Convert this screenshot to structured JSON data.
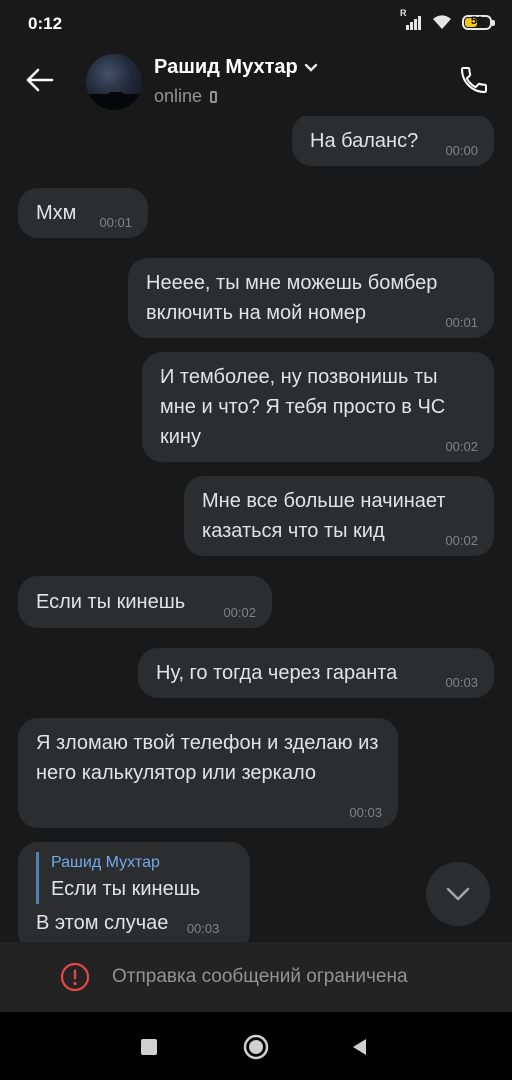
{
  "status_bar": {
    "time": "0:12",
    "signal_label": "R",
    "battery": "52",
    "battery_level": 0.52
  },
  "header": {
    "contact_name": "Рашид Мухтар",
    "status": "online",
    "icons": {
      "back": "back-arrow-icon",
      "call": "phone-icon",
      "dropdown": "chevron-down-icon",
      "device": "mobile-device-icon"
    }
  },
  "messages": [
    {
      "side": "out",
      "text": "На баланс?",
      "time": "00:00"
    },
    {
      "side": "in",
      "text": "Мхм",
      "time": "00:01"
    },
    {
      "side": "out",
      "text": "Нееее, ты мне можешь бомбер включить на мой номер",
      "time": "00:01"
    },
    {
      "side": "out",
      "text": "И темболее, ну позвонишь ты мне и что? Я тебя просто в ЧС кину",
      "time": "00:02"
    },
    {
      "side": "out",
      "text": "Мне все больше начинает казаться что ты кид",
      "time": "00:02"
    },
    {
      "side": "in",
      "text": "Если ты кинешь",
      "time": "00:02"
    },
    {
      "side": "out",
      "text": "Ну, го тогда через гаранта",
      "time": "00:03"
    },
    {
      "side": "in",
      "text": "Я зломаю твой телефон и зделаю из него калькулятор или зеркало",
      "time": "00:03"
    },
    {
      "side": "in",
      "reply_to": {
        "name": "Рашид Мухтар",
        "text": "Если ты кинешь"
      },
      "text": "В этом случае",
      "time": "00:03"
    }
  ],
  "restricted": {
    "text": "Отправка сообщений ограничена",
    "icon": "alert-circle-icon",
    "icon_color": "#e64646"
  },
  "colors": {
    "background": "#19191a",
    "bubble": "#2c2d2e",
    "reply_accent": "#5181b8",
    "reply_name": "#71aaeb"
  }
}
